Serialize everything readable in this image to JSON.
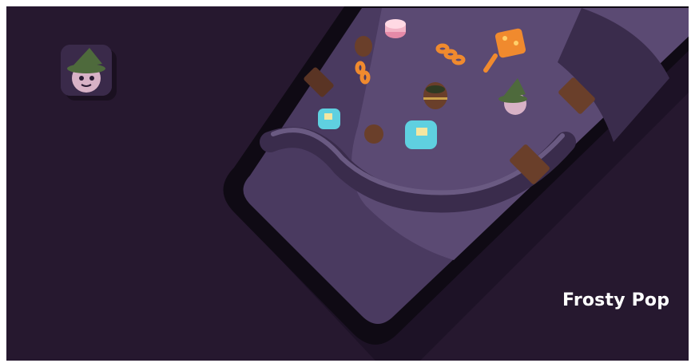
{
  "brand": {
    "title": "Frosty Pop",
    "app_icon": "witch-character-icon"
  },
  "colors": {
    "background": "#26182f",
    "phone_frame": "#0f0a14",
    "screen": "#4a3a60",
    "accent_orange": "#f08a2e",
    "accent_cyan": "#5fd0e0",
    "wood": "#6a3f2a"
  },
  "game_objects": [
    "witch-character-icon",
    "barrel-icon",
    "chain-link-icon",
    "crate-icon",
    "ice-block-icon",
    "cake-icon",
    "wooden-post-icon"
  ]
}
